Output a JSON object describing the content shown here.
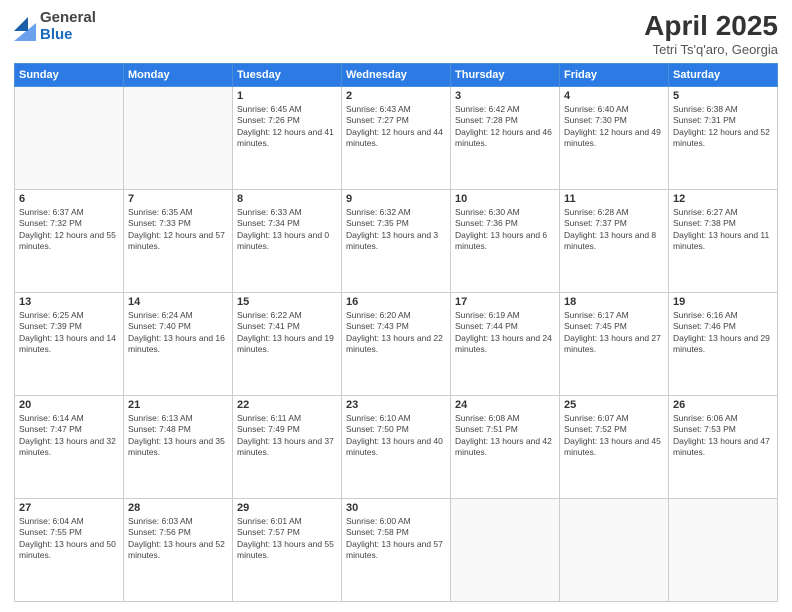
{
  "header": {
    "logo": {
      "general": "General",
      "blue": "Blue"
    },
    "title": "April 2025",
    "subtitle": "Tetri Ts'q'aro, Georgia"
  },
  "weekdays": [
    "Sunday",
    "Monday",
    "Tuesday",
    "Wednesday",
    "Thursday",
    "Friday",
    "Saturday"
  ],
  "weeks": [
    [
      {
        "day": null
      },
      {
        "day": null
      },
      {
        "day": "1",
        "sunrise": "Sunrise: 6:45 AM",
        "sunset": "Sunset: 7:26 PM",
        "daylight": "Daylight: 12 hours and 41 minutes."
      },
      {
        "day": "2",
        "sunrise": "Sunrise: 6:43 AM",
        "sunset": "Sunset: 7:27 PM",
        "daylight": "Daylight: 12 hours and 44 minutes."
      },
      {
        "day": "3",
        "sunrise": "Sunrise: 6:42 AM",
        "sunset": "Sunset: 7:28 PM",
        "daylight": "Daylight: 12 hours and 46 minutes."
      },
      {
        "day": "4",
        "sunrise": "Sunrise: 6:40 AM",
        "sunset": "Sunset: 7:30 PM",
        "daylight": "Daylight: 12 hours and 49 minutes."
      },
      {
        "day": "5",
        "sunrise": "Sunrise: 6:38 AM",
        "sunset": "Sunset: 7:31 PM",
        "daylight": "Daylight: 12 hours and 52 minutes."
      }
    ],
    [
      {
        "day": "6",
        "sunrise": "Sunrise: 6:37 AM",
        "sunset": "Sunset: 7:32 PM",
        "daylight": "Daylight: 12 hours and 55 minutes."
      },
      {
        "day": "7",
        "sunrise": "Sunrise: 6:35 AM",
        "sunset": "Sunset: 7:33 PM",
        "daylight": "Daylight: 12 hours and 57 minutes."
      },
      {
        "day": "8",
        "sunrise": "Sunrise: 6:33 AM",
        "sunset": "Sunset: 7:34 PM",
        "daylight": "Daylight: 13 hours and 0 minutes."
      },
      {
        "day": "9",
        "sunrise": "Sunrise: 6:32 AM",
        "sunset": "Sunset: 7:35 PM",
        "daylight": "Daylight: 13 hours and 3 minutes."
      },
      {
        "day": "10",
        "sunrise": "Sunrise: 6:30 AM",
        "sunset": "Sunset: 7:36 PM",
        "daylight": "Daylight: 13 hours and 6 minutes."
      },
      {
        "day": "11",
        "sunrise": "Sunrise: 6:28 AM",
        "sunset": "Sunset: 7:37 PM",
        "daylight": "Daylight: 13 hours and 8 minutes."
      },
      {
        "day": "12",
        "sunrise": "Sunrise: 6:27 AM",
        "sunset": "Sunset: 7:38 PM",
        "daylight": "Daylight: 13 hours and 11 minutes."
      }
    ],
    [
      {
        "day": "13",
        "sunrise": "Sunrise: 6:25 AM",
        "sunset": "Sunset: 7:39 PM",
        "daylight": "Daylight: 13 hours and 14 minutes."
      },
      {
        "day": "14",
        "sunrise": "Sunrise: 6:24 AM",
        "sunset": "Sunset: 7:40 PM",
        "daylight": "Daylight: 13 hours and 16 minutes."
      },
      {
        "day": "15",
        "sunrise": "Sunrise: 6:22 AM",
        "sunset": "Sunset: 7:41 PM",
        "daylight": "Daylight: 13 hours and 19 minutes."
      },
      {
        "day": "16",
        "sunrise": "Sunrise: 6:20 AM",
        "sunset": "Sunset: 7:43 PM",
        "daylight": "Daylight: 13 hours and 22 minutes."
      },
      {
        "day": "17",
        "sunrise": "Sunrise: 6:19 AM",
        "sunset": "Sunset: 7:44 PM",
        "daylight": "Daylight: 13 hours and 24 minutes."
      },
      {
        "day": "18",
        "sunrise": "Sunrise: 6:17 AM",
        "sunset": "Sunset: 7:45 PM",
        "daylight": "Daylight: 13 hours and 27 minutes."
      },
      {
        "day": "19",
        "sunrise": "Sunrise: 6:16 AM",
        "sunset": "Sunset: 7:46 PM",
        "daylight": "Daylight: 13 hours and 29 minutes."
      }
    ],
    [
      {
        "day": "20",
        "sunrise": "Sunrise: 6:14 AM",
        "sunset": "Sunset: 7:47 PM",
        "daylight": "Daylight: 13 hours and 32 minutes."
      },
      {
        "day": "21",
        "sunrise": "Sunrise: 6:13 AM",
        "sunset": "Sunset: 7:48 PM",
        "daylight": "Daylight: 13 hours and 35 minutes."
      },
      {
        "day": "22",
        "sunrise": "Sunrise: 6:11 AM",
        "sunset": "Sunset: 7:49 PM",
        "daylight": "Daylight: 13 hours and 37 minutes."
      },
      {
        "day": "23",
        "sunrise": "Sunrise: 6:10 AM",
        "sunset": "Sunset: 7:50 PM",
        "daylight": "Daylight: 13 hours and 40 minutes."
      },
      {
        "day": "24",
        "sunrise": "Sunrise: 6:08 AM",
        "sunset": "Sunset: 7:51 PM",
        "daylight": "Daylight: 13 hours and 42 minutes."
      },
      {
        "day": "25",
        "sunrise": "Sunrise: 6:07 AM",
        "sunset": "Sunset: 7:52 PM",
        "daylight": "Daylight: 13 hours and 45 minutes."
      },
      {
        "day": "26",
        "sunrise": "Sunrise: 6:06 AM",
        "sunset": "Sunset: 7:53 PM",
        "daylight": "Daylight: 13 hours and 47 minutes."
      }
    ],
    [
      {
        "day": "27",
        "sunrise": "Sunrise: 6:04 AM",
        "sunset": "Sunset: 7:55 PM",
        "daylight": "Daylight: 13 hours and 50 minutes."
      },
      {
        "day": "28",
        "sunrise": "Sunrise: 6:03 AM",
        "sunset": "Sunset: 7:56 PM",
        "daylight": "Daylight: 13 hours and 52 minutes."
      },
      {
        "day": "29",
        "sunrise": "Sunrise: 6:01 AM",
        "sunset": "Sunset: 7:57 PM",
        "daylight": "Daylight: 13 hours and 55 minutes."
      },
      {
        "day": "30",
        "sunrise": "Sunrise: 6:00 AM",
        "sunset": "Sunset: 7:58 PM",
        "daylight": "Daylight: 13 hours and 57 minutes."
      },
      {
        "day": null
      },
      {
        "day": null
      },
      {
        "day": null
      }
    ]
  ]
}
